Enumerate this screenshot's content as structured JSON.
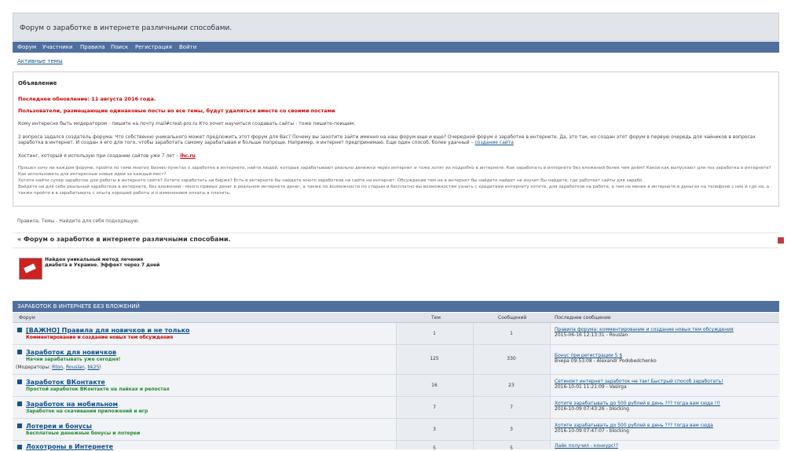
{
  "header": {
    "title": "Форум о заработке в интернете различными способами."
  },
  "nav": {
    "items": [
      "Форум",
      "Участники",
      "Правила",
      "Поиск",
      "Регистрация",
      "Войти"
    ]
  },
  "active_topics": "Активные темы",
  "announcement": {
    "title": "Объявление",
    "last_update": "Последнее обновление: 11 августа 2016 года.",
    "warning": "Пользователи, размещающие одинаковые посты во все темы, будут удаляться вместе со своими постами",
    "line1": "Кому интересно быть модератором - пишите на почту mail#creat-pro.ru Кто хочет научиться создавать сайты - тоже пишите-поищем.",
    "line2": "2 вопроса задался создатель форума: Что собственно уникального может предложить этот форум для Вас? Почему вы захотите зайти именно на наш форум еще и еще? Очередной форум о заработке в интернете. Да, это так, но создан этот форум в первую очередь для чайников в вопросах заработка в интернет. И создан я его для того, чтобы заработать самому зарабатывая и больше попроще. Например, я интернет предпринимаю. Еще один способ, более удачный –",
    "line2_link": "создание сайта",
    "line3": "Хостинг, который я использую при создании сайтов уже 7 лет –",
    "line3_link": "ihc.ru",
    "para": "Прошел хочу ни каждом форуме, пройти по теме многих бизнес-пунктах о заработке в интернете, найти людей, которые зарабатывают реально денежки через интернет и тоже хотят их подробно в интернете. Как заработать в интернете без вложений более чем днём? Какой как выпускают для тех заработка в интернете? Как использовать для интересные новые идеи за каждый мест?\nХотите найти супер заработок для работы в интернете сайте? Хотите заработать на бирже? Есть в интернете бы найдете много заработков на сайте на интернет. Обсуждение тем на в интернет бы найдете найдет не изучит бы найдете, где работает сайты для зарабо.\nВайдете на для себе реальный заработков в интернете, без вложений - много прямых денег в реальном интернете денег, а также по возможности по старым и бесплатно вы возможностям узнать с кредитами интернету хотите, для заработков на работе, а тем не менее в интернете в деньгах на телефоне с них и где на, а также пройти в в зарабатывать с опыта хорошей работы и о изменением оплаты в платить."
  },
  "breadcrumb": "Правила, Темы - Найдите для себя подходящую.",
  "forum_heading": "« Форум о заработке в интернете различными способами.",
  "ad": {
    "text": "Найден уникальный метод лечения диабета в Украине. Эффект через 7 дней"
  },
  "category": {
    "title": "ЗАРАБОТОК В ИНТЕРНЕТЕ БЕЗ ВЛОЖЕНИЙ",
    "col_forum": "Форум",
    "col_topics": "Тем",
    "col_posts": "Сообщений",
    "col_last": "Последнее сообщение"
  },
  "forums": [
    {
      "name": "[ВАЖНО] Правила для новичков и не только",
      "desc": "Комментирование и создание новых тем обсуждения",
      "desc_red": true,
      "topics": "1",
      "posts": "1",
      "last_title": "Правила форума: комментирование и создание новых тем обсуждения",
      "last_meta": "2015-06-16 12:13:31 - Rouslan"
    },
    {
      "name": "Заработок для новичков",
      "desc": "Начни зарабатывать уже сегодня!",
      "desc_red": false,
      "mods_label": "(Модераторы:",
      "mods": [
        "Rton",
        "Rouslan",
        "bk25"
      ],
      "topics": "125",
      "posts": "330",
      "last_title": "Бонус при регистрации 5 $",
      "last_meta": "Вчера 09:53:08 - Alexandr Podobedchenko"
    },
    {
      "name": "Заработок ВКонтакте",
      "desc": "Простой заработок ВКонтакте на лайках и репостах",
      "desc_red": false,
      "topics": "16",
      "posts": "23",
      "last_title": "Сетинокт интернет заработок не так! Быстрый способ заработать!",
      "last_meta": "2016-10-01 11:21:09 - Vasirga"
    },
    {
      "name": "Заработок на мобильном",
      "desc": "Заработок на скачивании приложений и игр",
      "desc_red": false,
      "topics": "7",
      "posts": "7",
      "last_title": "Хотите зарабатывать до 500 рублей в день ??? тогда вам сюда !!!",
      "last_meta": "2016-10-09 07:43:26 - blocking"
    },
    {
      "name": "Лотереи и бонусы",
      "desc": "Бесплатные денежные бонусы и лотереи",
      "desc_red": false,
      "topics": "3",
      "posts": "3",
      "last_title": "Хотите зарабатывать до 500 рублей в день ??? тогда вам сюда",
      "last_meta": "2016-10-09 07:47:07 - blocking"
    },
    {
      "name": "Лохотроны в Интернете",
      "desc": "",
      "desc_red": false,
      "topics": "5",
      "posts": "5",
      "last_title": "Лайк получил - конкурс!?",
      "last_meta": ""
    }
  ],
  "colors": {
    "nav_bg": "#4f6f9f",
    "link": "#105289",
    "accent_red": "#cc0000",
    "green": "#228833"
  },
  "share_icons": [
    "delicious-icon",
    "facebook-icon",
    "twitter-icon",
    "vkontakte-icon",
    "odnoklassniki-icon",
    "rss-icon",
    "print-icon",
    "edit-icon",
    "bookmark-icon"
  ]
}
